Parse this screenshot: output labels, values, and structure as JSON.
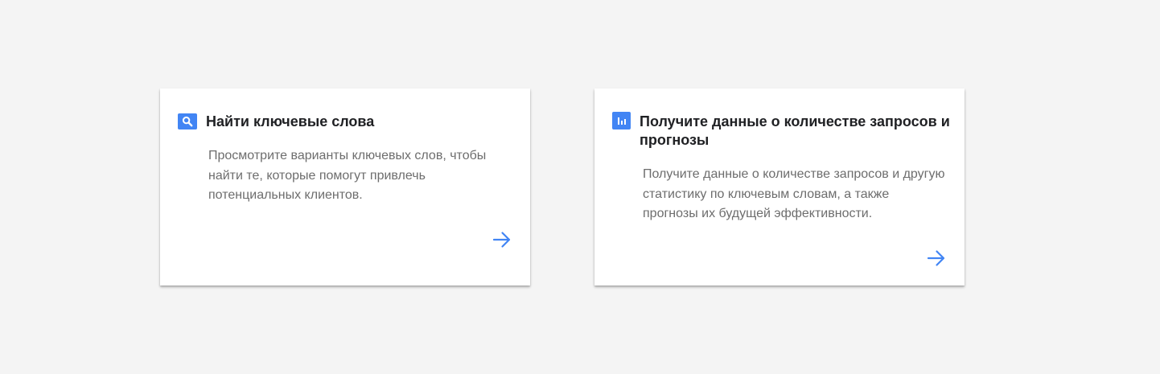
{
  "colors": {
    "background": "#f4f4f4",
    "card": "#ffffff",
    "accent": "#4285f4",
    "title": "#202124",
    "description": "#6d6d6d"
  },
  "cards": [
    {
      "icon": "search-icon",
      "title": "Найти ключевые слова",
      "description": "Просмотрите варианты ключевых слов, чтобы найти те, которые помогут привлечь потенциальных клиентов.",
      "action_icon": "arrow-right-icon"
    },
    {
      "icon": "bar-chart-icon",
      "title": "Получите данные о количестве запросов и прогнозы",
      "description": "Получите данные о количестве запросов и другую статистику по ключевым словам, а также прогнозы их будущей эффективности.",
      "action_icon": "arrow-right-icon"
    }
  ]
}
